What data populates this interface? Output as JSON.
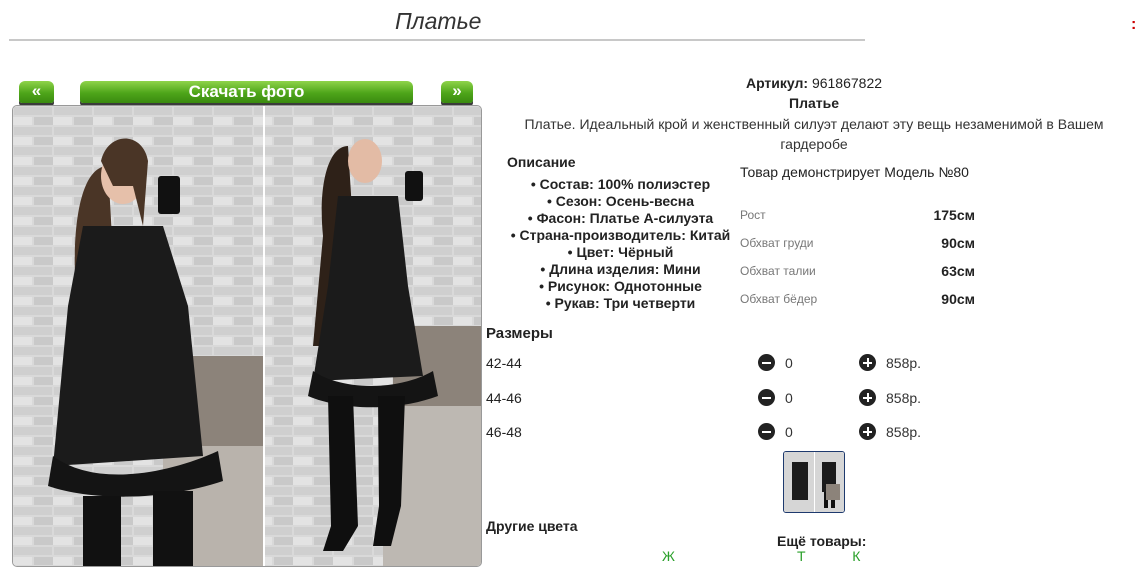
{
  "page": {
    "title": "Платье"
  },
  "nav": {
    "prev_label": "«",
    "download_label": "Скачать фото",
    "next_label": "»"
  },
  "product": {
    "sku_label": "Артикул:",
    "sku_value": "961867822",
    "name": "Платье",
    "description": "Платье. Идеальный крой и женственный силуэт делают эту вещь незаменимой в Вашем гардеробе"
  },
  "details": {
    "heading": "Описание",
    "attributes": [
      "Состав: 100% полиэстер",
      "Сезон: Осень-весна",
      "Фасон: Платье А-силуэта",
      "Страна-производитель: Китай",
      "Цвет: Чёрный",
      "Длина изделия: Мини",
      "Рисунок: Однотонные",
      "Рукав: Три четверти"
    ]
  },
  "model": {
    "note": "Товар демонстрирует Модель №80",
    "measurements": [
      {
        "label": "Рост",
        "value": "175см"
      },
      {
        "label": "Обхват груди",
        "value": "90см"
      },
      {
        "label": "Обхват талии",
        "value": "63см"
      },
      {
        "label": "Обхват бёдер",
        "value": "90см"
      }
    ]
  },
  "sizes": {
    "heading": "Размеры",
    "rows": [
      {
        "size": "42-44",
        "qty": "0",
        "price": "858р."
      },
      {
        "size": "44-46",
        "qty": "0",
        "price": "858р."
      },
      {
        "size": "46-48",
        "qty": "0",
        "price": "858р."
      }
    ]
  },
  "footer": {
    "other_colors": "Другие цвета",
    "more_goods": "Ещё товары:",
    "fragment_left": "Ж",
    "fragment_right": "Т            К"
  },
  "colors": {
    "button_green": "#4ea51a",
    "accent_green": "#2aa02a",
    "thumb_border": "#1e3a6e"
  }
}
